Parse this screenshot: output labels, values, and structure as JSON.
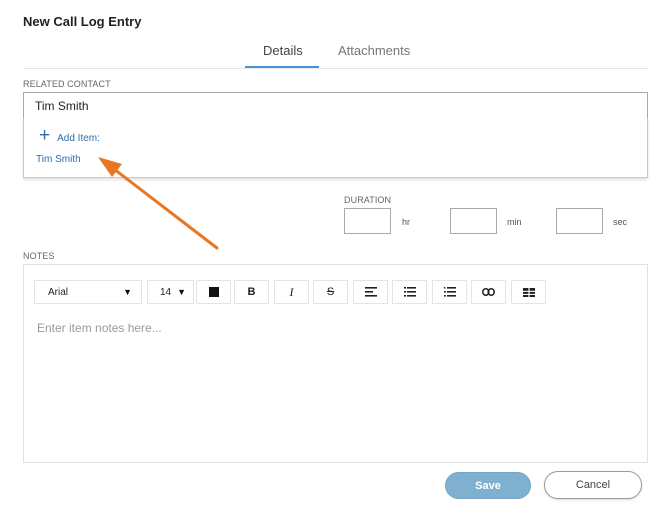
{
  "dialog": {
    "title": "New Call Log Entry",
    "tabs": [
      {
        "label": "Details",
        "active": true
      },
      {
        "label": "Attachments",
        "active": false
      }
    ]
  },
  "related_contact": {
    "label": "RELATED CONTACT",
    "value": "Tim Smith",
    "dropdown": {
      "add_item_icon": "plus-icon",
      "add_item_label": "Add Item:",
      "options": [
        "Tim Smith"
      ]
    }
  },
  "duration": {
    "label": "DURATION",
    "units": {
      "hr": "hr",
      "min": "min",
      "sec": "sec"
    },
    "values": {
      "hr": "",
      "min": "",
      "sec": ""
    }
  },
  "notes": {
    "label": "NOTES",
    "placeholder": "Enter item notes here...",
    "toolbar": {
      "font": "Arial",
      "size": "14",
      "caret": "▼",
      "bold": "B",
      "italic": "I",
      "strike": "S",
      "text_color": "#111111"
    }
  },
  "actions": {
    "save_label": "Save",
    "cancel_label": "Cancel"
  },
  "colors": {
    "accent": "#4a90d9",
    "link": "#2e6ea8",
    "save_button": "#7fb0cf",
    "annotation_arrow": "#e87722"
  }
}
